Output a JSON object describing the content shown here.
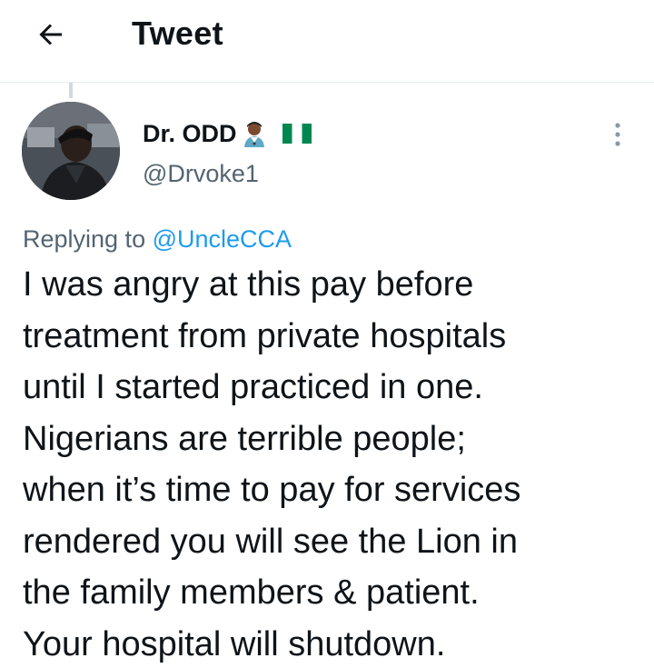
{
  "header": {
    "back_icon": "arrow-left-icon",
    "title": "Tweet"
  },
  "tweet": {
    "author": {
      "display_name": "Dr. ODD",
      "name_emoji": "health-worker-emoji",
      "flag": "nigeria-flag",
      "handle": "@Drvoke1"
    },
    "more_icon": "more-vertical-icon",
    "replying_prefix": "Replying to",
    "replying_to": "@UncleCCA",
    "text_lines": [
      "I was angry at this pay before",
      "treatment from private hospitals",
      "until I started practiced in one.",
      "Nigerians are terrible people;",
      "when it’s time to pay for services",
      "rendered you will see the Lion in",
      "the family members & patient.",
      "Your hospital will shutdown."
    ]
  },
  "colors": {
    "text": "#0f1419",
    "secondary": "#536471",
    "link": "#1d9bf0",
    "flag_green": "#008751",
    "divider": "#e6ecf0"
  }
}
